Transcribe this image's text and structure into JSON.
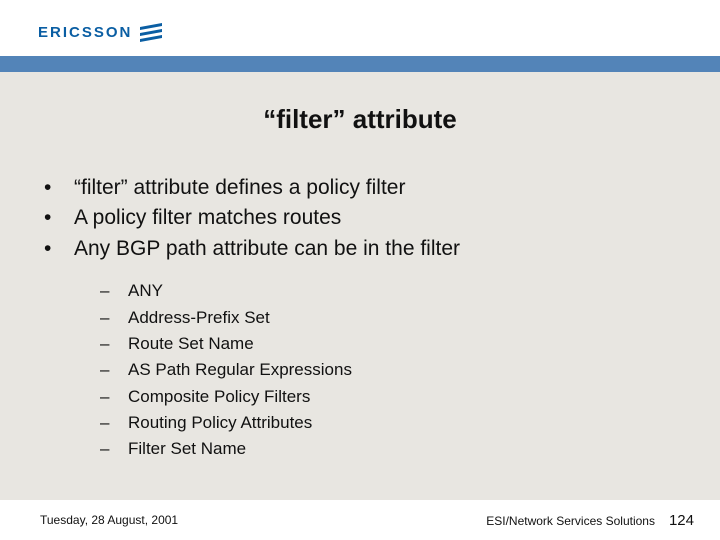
{
  "brand": {
    "name": "ERICSSON"
  },
  "title": "“filter” attribute",
  "bullets": [
    "“filter” attribute defines a policy filter",
    "A policy filter matches routes",
    "Any BGP path attribute can be in the filter"
  ],
  "sub_bullets": [
    "ANY",
    "Address-Prefix Set",
    "Route Set Name",
    "AS Path Regular Expressions",
    "Composite Policy Filters",
    "Routing Policy Attributes",
    "Filter Set Name"
  ],
  "footer": {
    "date": "Tuesday, 28 August, 2001",
    "org": "ESI/Network Services Solutions",
    "page": "124"
  }
}
